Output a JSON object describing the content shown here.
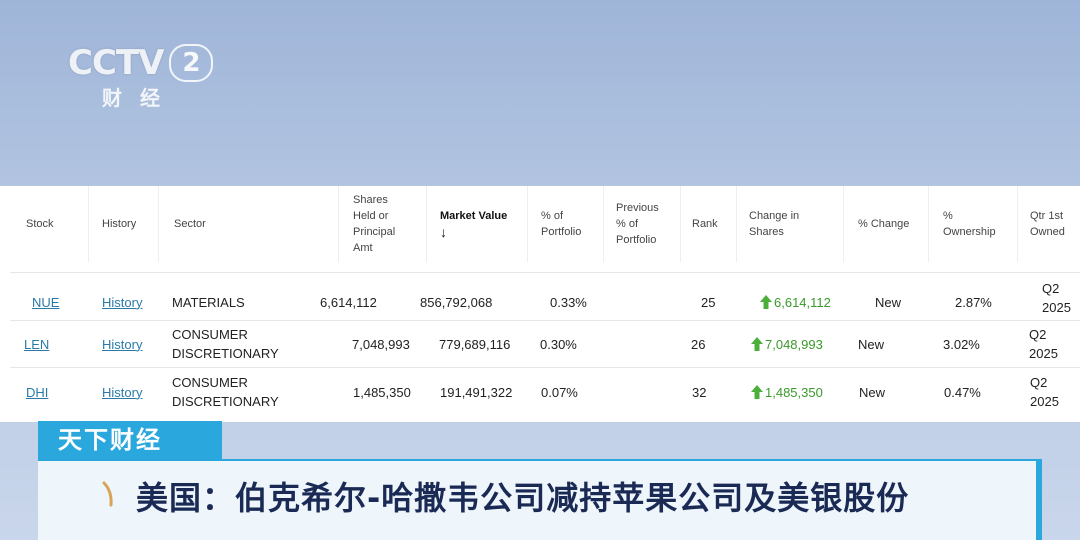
{
  "logo": {
    "brand": "CCTV",
    "channel": "2",
    "subtitle": "财经"
  },
  "table": {
    "headers": {
      "stock": "Stock",
      "history": "History",
      "sector": "Sector",
      "shares": [
        "Shares",
        "Held or",
        "Principal",
        "Amt"
      ],
      "market_value": "Market Value",
      "pct_portfolio": [
        "% of",
        "Portfolio"
      ],
      "prev_pct": [
        "Previous",
        "% of",
        "Portfolio"
      ],
      "rank": "Rank",
      "change_shares": [
        "Change in",
        "Shares"
      ],
      "pct_change": "% Change",
      "pct_ownership": [
        "%",
        "Ownership"
      ],
      "qtr_first": [
        "Qtr 1st",
        "Owned"
      ]
    },
    "rows": [
      {
        "stock": "NUE",
        "history": "History",
        "sector": [
          "MATERIALS"
        ],
        "shares": "6,614,112",
        "market_value": "856,792,068",
        "pct_portfolio": "0.33%",
        "prev_pct": "",
        "rank": "25",
        "change_shares": "6,614,112",
        "pct_change": "New",
        "pct_ownership": "2.87%",
        "qtr": [
          "Q2",
          "2025"
        ]
      },
      {
        "stock": "LEN",
        "history": "History",
        "sector": [
          "CONSUMER",
          "DISCRETIONARY"
        ],
        "shares": "7,048,993",
        "market_value": "779,689,116",
        "pct_portfolio": "0.30%",
        "prev_pct": "",
        "rank": "26",
        "change_shares": "7,048,993",
        "pct_change": "New",
        "pct_ownership": "3.02%",
        "qtr": [
          "Q2",
          "2025"
        ]
      },
      {
        "stock": "DHI",
        "history": "History",
        "sector": [
          "CONSUMER",
          "DISCRETIONARY"
        ],
        "shares": "1,485,350",
        "market_value": "191,491,322",
        "pct_portfolio": "0.07%",
        "prev_pct": "",
        "rank": "32",
        "change_shares": "1,485,350",
        "pct_change": "New",
        "pct_ownership": "0.47%",
        "qtr": [
          "Q2",
          "2025"
        ]
      }
    ]
  },
  "banner": {
    "tag": "天下财经",
    "headline": "美国：伯克希尔-哈撒韦公司减持苹果公司及美银股份"
  },
  "colors": {
    "accent": "#2aa7dd",
    "link": "#2a7aa8",
    "up": "#3a9a2a",
    "headline": "#1a2a55"
  }
}
